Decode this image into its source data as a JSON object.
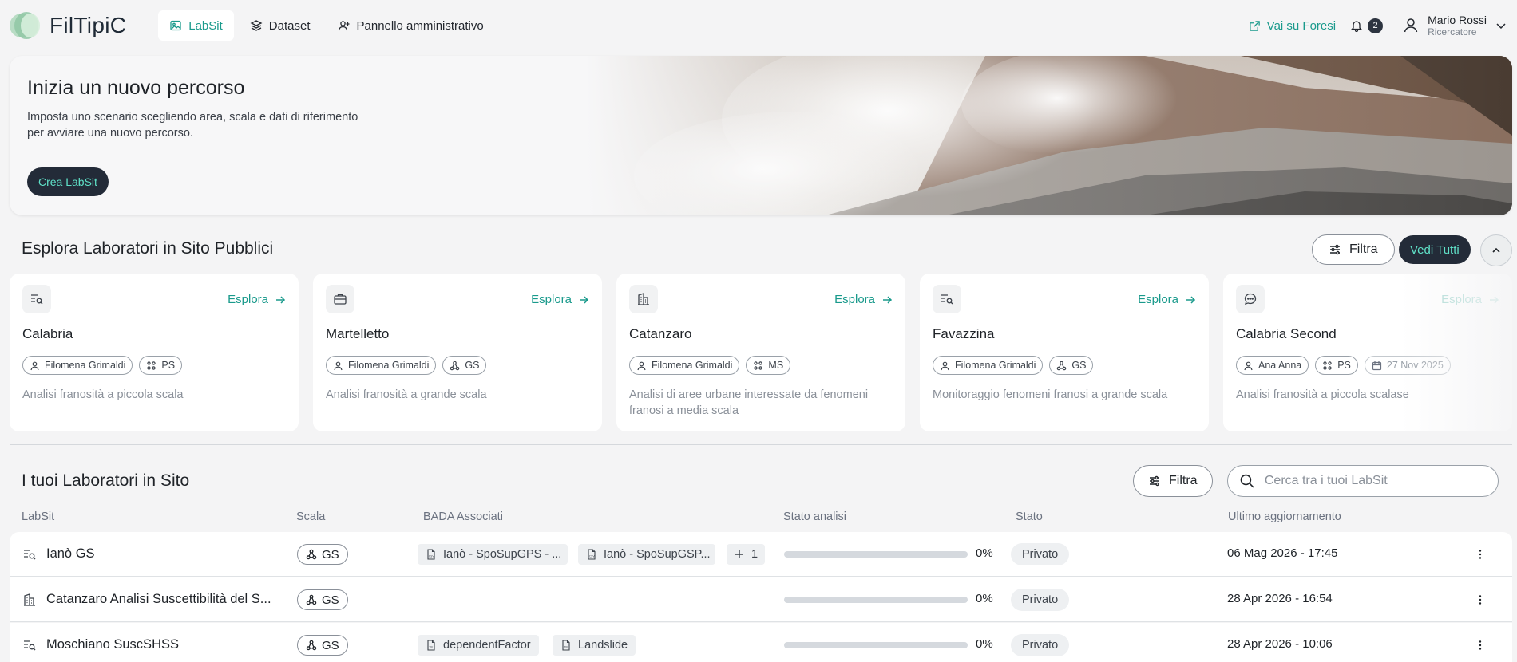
{
  "app": {
    "logo_text": "FilTipiC"
  },
  "nav": [
    {
      "label": "LabSit",
      "active": true
    },
    {
      "label": "Dataset",
      "active": false
    },
    {
      "label": "Pannello amministrativo",
      "active": false
    }
  ],
  "topbar": {
    "foresi_label": "Vai su Foresi",
    "notif_count": "2"
  },
  "user": {
    "name": "Mario Rossi",
    "role": "Ricercatore"
  },
  "hero": {
    "title": "Inizia un nuovo percorso",
    "desc_line1": "Imposta uno scenario scegliendo area, scala e dati di riferimento",
    "desc_line2": "per avviare una nuovo percorso.",
    "cta": "Crea LabSit"
  },
  "explore": {
    "title": "Esplora Laboratori in Sito Pubblici",
    "filter_label": "Filtra",
    "see_all_label": "Vedi Tutti",
    "explore_label": "Esplora",
    "cards": [
      {
        "icon": "search-list-icon",
        "title": "Calabria",
        "owner": "Filomena Grimaldi",
        "scale": "PS",
        "date": "",
        "desc": "Analisi franosità a piccola scala"
      },
      {
        "icon": "briefcase-icon",
        "title": "Martelletto",
        "owner": "Filomena Grimaldi",
        "scale": "GS",
        "date": "",
        "desc": "Analisi franosità a grande scala"
      },
      {
        "icon": "buildings-icon",
        "title": "Catanzaro",
        "owner": "Filomena Grimaldi",
        "scale": "MS",
        "date": "",
        "desc": "Analisi di aree urbane interessate da fenomeni franosi a media scala"
      },
      {
        "icon": "search-list-icon",
        "title": "Favazzina",
        "owner": "Filomena Grimaldi",
        "scale": "GS",
        "date": "",
        "desc": "Monitoraggio fenomeni franosi a grande scala"
      },
      {
        "icon": "chat-bubble-icon",
        "title": "Calabria Second",
        "owner": "Ana Anna",
        "scale": "PS",
        "date": "27 Nov 2025",
        "desc": "Analisi franosità a piccola scalase"
      }
    ]
  },
  "mine": {
    "title": "I tuoi Laboratori in Sito",
    "filter_label": "Filtra",
    "search_placeholder": "Cerca tra i tuoi LabSit",
    "columns": [
      "LabSit",
      "Scala",
      "BADA Associati",
      "Stato analisi",
      "Stato",
      "Ultimo aggiornamento"
    ],
    "rows": [
      {
        "icon": "search-list-icon",
        "name": "Ianò GS",
        "scale": "GS",
        "bada": [
          {
            "label": "Ianò - SpoSupGPS - ...",
            "type": "csv"
          },
          {
            "label": "Ianò - SpoSupGSP...",
            "type": "csv"
          }
        ],
        "bada_more": "1",
        "progress": 0,
        "progress_label": "0%",
        "status": "Privato",
        "updated": "06 Mag 2026 - 17:45"
      },
      {
        "icon": "buildings-icon",
        "name": "Catanzaro Analisi Suscettibilità del S...",
        "scale": "GS",
        "bada": [],
        "bada_more": "",
        "progress": 0,
        "progress_label": "0%",
        "status": "Privato",
        "updated": "28 Apr 2026 - 16:54"
      },
      {
        "icon": "search-list-icon",
        "name": "Moschiano SuscSHSS",
        "scale": "GS",
        "bada": [
          {
            "label": "dependentFactor",
            "type": "tif"
          },
          {
            "label": "Landslide",
            "type": "tif"
          }
        ],
        "bada_more": "",
        "progress": 0,
        "progress_label": "0%",
        "status": "Privato",
        "updated": "28 Apr 2026 - 10:06"
      }
    ]
  },
  "colors": {
    "accent": "#1a9a8c",
    "dark": "#232b38",
    "cta_text": "#5fe0c7"
  }
}
